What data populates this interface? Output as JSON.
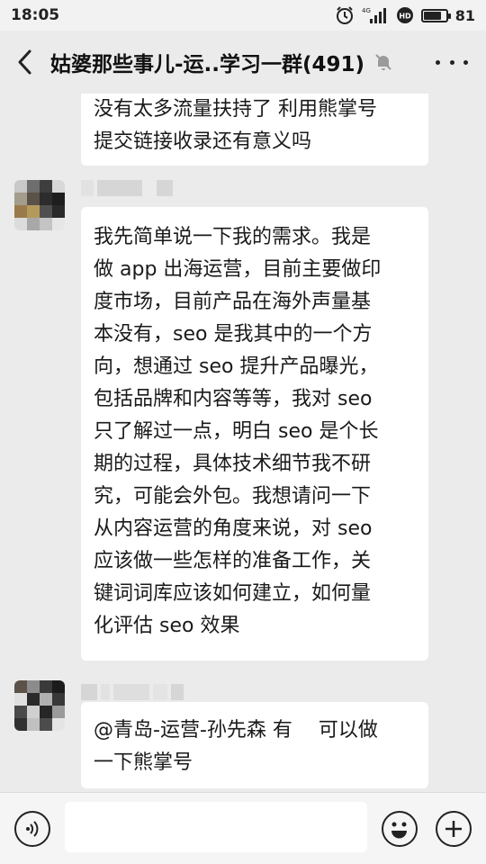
{
  "status_bar": {
    "time": "18:05",
    "network": "4G",
    "hd": "HD",
    "battery_level": "81",
    "battery_fraction": 0.81
  },
  "header": {
    "title": "姑婆那些事儿-运..学习一群(491)",
    "back_icon": "chevron-left-icon",
    "mute_icon": "bell-off-icon",
    "more_icon": "ellipsis-icon"
  },
  "messages": [
    {
      "type": "received",
      "lines": [
        "没有太多流量扶持了 利用熊掌号",
        "提交链接收录还有意义吗"
      ]
    },
    {
      "type": "received",
      "lines": [
        "我先简单说一下我的需求。我是",
        "做 app 出海运营，目前主要做印",
        "度市场，目前产品在海外声量基",
        "本没有，seo 是我其中的一个方",
        "向，想通过 seo 提升产品曝光，",
        "包括品牌和内容等等，我对 seo",
        "只了解过一点，明白 seo 是个长",
        "期的过程，具体技术细节我不研",
        "究，可能会外包。我想请问一下",
        "从内容运营的角度来说，对 seo",
        "应该做一些怎样的准备工作，关",
        "键词词库应该如何建立，如何量",
        "化评估 seo 效果"
      ]
    },
    {
      "type": "received",
      "lines": [
        "@青岛-运营-孙先森 有　 可以做",
        "一下熊掌号"
      ]
    }
  ],
  "input_bar": {
    "text": "",
    "voice_icon": "voice-icon",
    "emoji_icon": "emoji-icon",
    "plus_icon": "plus-icon"
  }
}
